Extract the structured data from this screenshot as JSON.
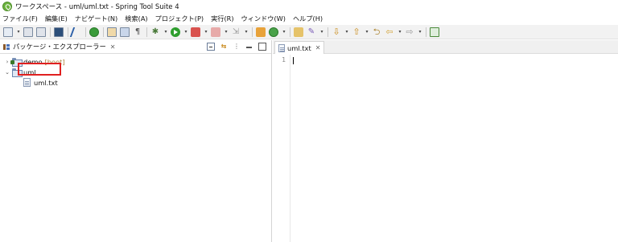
{
  "window": {
    "title": "ワークスペース - uml/uml.txt - Spring Tool Suite 4",
    "logo_icon": "spring-leaf-icon"
  },
  "menu": [
    {
      "label": "ファイル(F)"
    },
    {
      "label": "編集(E)"
    },
    {
      "label": "ナビゲート(N)"
    },
    {
      "label": "検索(A)"
    },
    {
      "label": "プロジェクト(P)"
    },
    {
      "label": "実行(R)"
    },
    {
      "label": "ウィンドウ(W)"
    },
    {
      "label": "ヘルプ(H)"
    }
  ],
  "toolbar": {
    "icons": [
      "new-icon",
      "save-icon",
      "save-all-icon",
      "terminal-icon",
      "toggle-mark-icon",
      "boot-dashboard-icon",
      "open-type-icon",
      "open-task-icon",
      "show-whitespace-icon",
      "debug-icon",
      "run-icon",
      "coverage-icon",
      "stop-icon",
      "external-tools-icon",
      "new-package-icon",
      "new-class-icon",
      "open-perspective-icon",
      "search-icon",
      "next-annotation-icon",
      "prev-annotation-icon",
      "last-edit-icon",
      "back-icon",
      "forward-icon",
      "pin-editor-icon"
    ]
  },
  "package_explorer": {
    "title": "パッケージ・エクスプローラー",
    "close_label": "✕",
    "tree": [
      {
        "label": "demo",
        "decoration": "[boot]",
        "expanded": false,
        "type": "project"
      },
      {
        "label": "uml",
        "expanded": true,
        "type": "project"
      },
      {
        "label": "uml.txt",
        "type": "file",
        "highlighted": true
      }
    ]
  },
  "editor": {
    "tab_label": "uml.txt",
    "close_label": "✕",
    "line_numbers": [
      "1"
    ],
    "content": ""
  },
  "colors": {
    "highlight_border": "#e02020",
    "toolbar_bg": "#f2f2f2",
    "decoration_text": "#a9803a"
  }
}
